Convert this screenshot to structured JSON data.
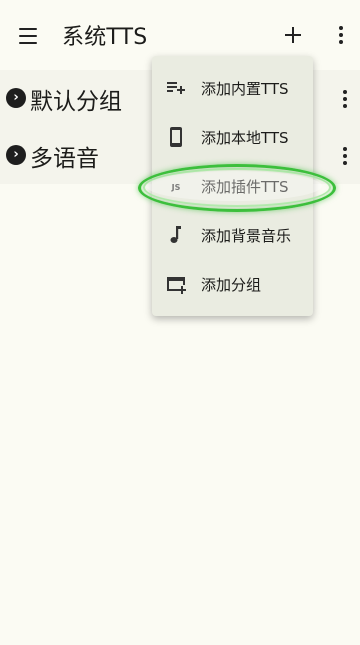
{
  "appbar": {
    "title": "系统TTS",
    "icons": {
      "menu": "hamburger-menu-icon",
      "add": "plus-icon",
      "more": "more-vert-icon"
    }
  },
  "groups": [
    {
      "label": "默认分组",
      "icon": "chevron-right-circle-icon"
    },
    {
      "label": "多语音",
      "icon": "chevron-right-circle-icon"
    }
  ],
  "popup_menu": {
    "items": [
      {
        "label": "添加内置TTS",
        "icon": "playlist-add-icon"
      },
      {
        "label": "添加本地TTS",
        "icon": "phone-icon"
      },
      {
        "label": "添加插件TTS",
        "icon": "js-plugin-icon",
        "icon_text": "JS"
      },
      {
        "label": "添加背景音乐",
        "icon": "music-note-icon"
      },
      {
        "label": "添加分组",
        "icon": "add-card-icon"
      }
    ]
  },
  "colors": {
    "background": "#fbfbf3",
    "popup": "#eaece1",
    "highlight_ring": "#3cbf3c"
  }
}
